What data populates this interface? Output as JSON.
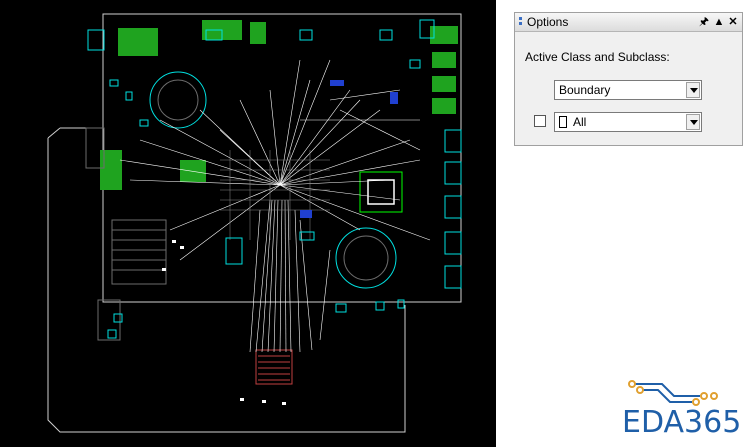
{
  "options_panel": {
    "title": "Options",
    "pin_icon": "pin-icon",
    "menu_icon": "triangle-up-icon",
    "close_icon": "close-icon",
    "active_class_label": "Active Class and Subclass:",
    "class_value": "Boundary",
    "subclass_value": "All",
    "subclass_checked": false
  },
  "logo": {
    "text": "EDA365",
    "text_color": "#1f5fa8",
    "trace_color": "#e0a030"
  },
  "canvas": {
    "background": "#000000",
    "outline_color": "#ffffff",
    "copper_color": "#00c000",
    "pad_color": "#00ffff",
    "ratsnest_color": "#ffffff"
  }
}
